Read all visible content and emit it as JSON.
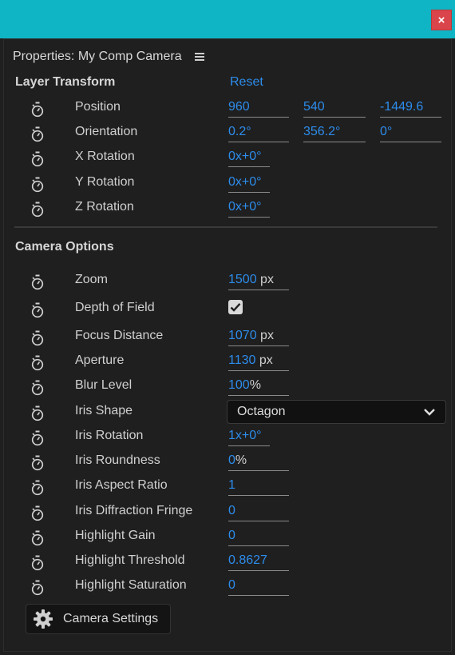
{
  "window": {
    "close_label": "×"
  },
  "panel": {
    "title": "Properties: My Comp Camera"
  },
  "layer_transform": {
    "title": "Layer Transform",
    "reset_label": "Reset",
    "rows": [
      {
        "label": "Position",
        "fields": [
          {
            "value": "960",
            "unit": ""
          },
          {
            "value": "540",
            "unit": ""
          },
          {
            "value": "-1449.6",
            "unit": ""
          }
        ]
      },
      {
        "label": "Orientation",
        "fields": [
          {
            "value": "0.2°",
            "unit": ""
          },
          {
            "value": "356.2°",
            "unit": ""
          },
          {
            "value": "0°",
            "unit": ""
          }
        ]
      },
      {
        "label": "X Rotation",
        "fields": [
          {
            "value": "0x+0°",
            "unit": ""
          }
        ]
      },
      {
        "label": "Y Rotation",
        "fields": [
          {
            "value": "0x+0°",
            "unit": ""
          }
        ]
      },
      {
        "label": "Z Rotation",
        "fields": [
          {
            "value": "0x+0°",
            "unit": ""
          }
        ]
      }
    ]
  },
  "camera_options": {
    "title": "Camera Options",
    "zoom": {
      "label": "Zoom",
      "value": "1500",
      "unit": "px"
    },
    "depth_of_field": {
      "label": "Depth of Field",
      "checked": true
    },
    "focus_distance": {
      "label": "Focus Distance",
      "value": "1070",
      "unit": "px"
    },
    "aperture": {
      "label": "Aperture",
      "value": "1130",
      "unit": "px"
    },
    "blur_level": {
      "label": "Blur Level",
      "value": "100",
      "unit": "%"
    },
    "iris_shape": {
      "label": "Iris Shape",
      "selected": "Octagon"
    },
    "iris_rotation": {
      "label": "Iris Rotation",
      "value": "1x+0°",
      "unit": ""
    },
    "iris_roundness": {
      "label": "Iris Roundness",
      "value": "0",
      "unit": "%"
    },
    "iris_aspect_ratio": {
      "label": "Iris Aspect Ratio",
      "value": "1",
      "unit": ""
    },
    "iris_diffraction_fringe": {
      "label": "Iris Diffraction Fringe",
      "value": "0",
      "unit": ""
    },
    "highlight_gain": {
      "label": "Highlight Gain",
      "value": "0",
      "unit": ""
    },
    "highlight_threshold": {
      "label": "Highlight Threshold",
      "value": "0.8627",
      "unit": ""
    },
    "highlight_saturation": {
      "label": "Highlight Saturation",
      "value": "0",
      "unit": ""
    }
  },
  "camera_settings_button": {
    "label": "Camera Settings"
  },
  "colors": {
    "titlebar": "#0fb5c4",
    "value_blue": "#2d8ceb",
    "close_red": "#d9454a",
    "panel_bg": "#1f1f1f"
  }
}
